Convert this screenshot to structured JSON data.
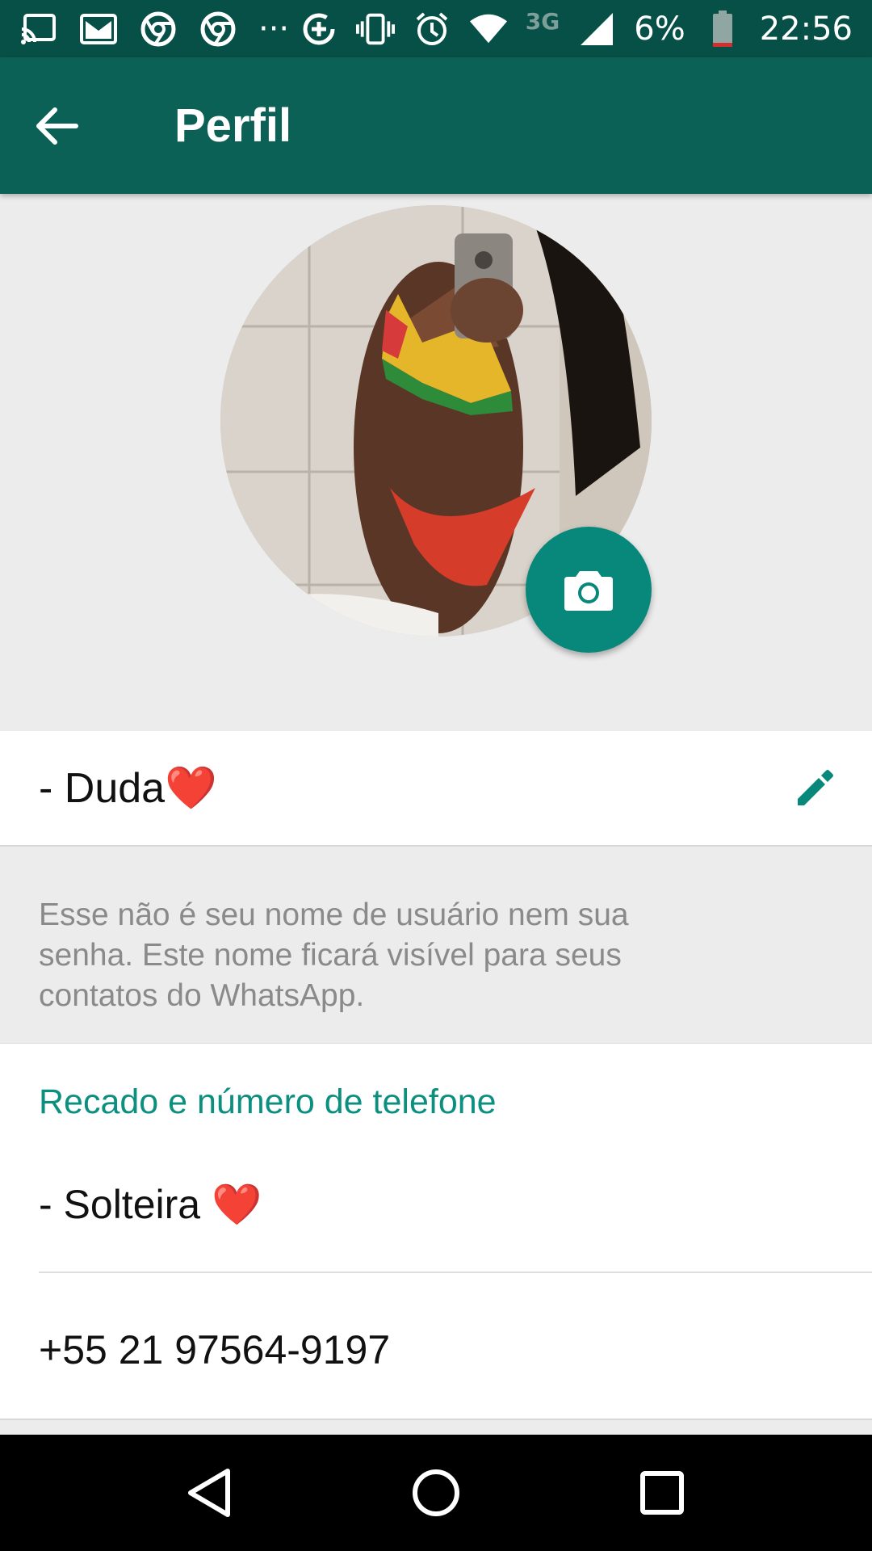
{
  "status_bar": {
    "battery": "6%",
    "time": "22:56",
    "network": "3G",
    "left_icons": [
      "cast-icon",
      "gmail-icon",
      "chrome-icon",
      "chrome-icon",
      "more-dots-icon"
    ],
    "more_dots": "···",
    "right_icons": [
      "data-saver-icon",
      "vibrate-icon",
      "alarm-icon",
      "wifi-icon",
      "signal-icon",
      "battery-icon"
    ]
  },
  "app_bar": {
    "title": "Perfil",
    "back_icon": "arrow-back-icon",
    "color": "#0b6156"
  },
  "profile": {
    "name": "- Duda❤️",
    "name_hint": "Esse não é seu nome de usuário nem sua senha. Este nome ficará visível para seus contatos do WhatsApp.",
    "about_heading": "Recado e número de telefone",
    "status": "- Solteira ❤️",
    "phone": "+55 21 97564-9197",
    "accent_color": "#07887a"
  },
  "nav_bar": {
    "buttons": [
      "back-triangle-icon",
      "home-circle-icon",
      "recents-square-icon"
    ]
  }
}
